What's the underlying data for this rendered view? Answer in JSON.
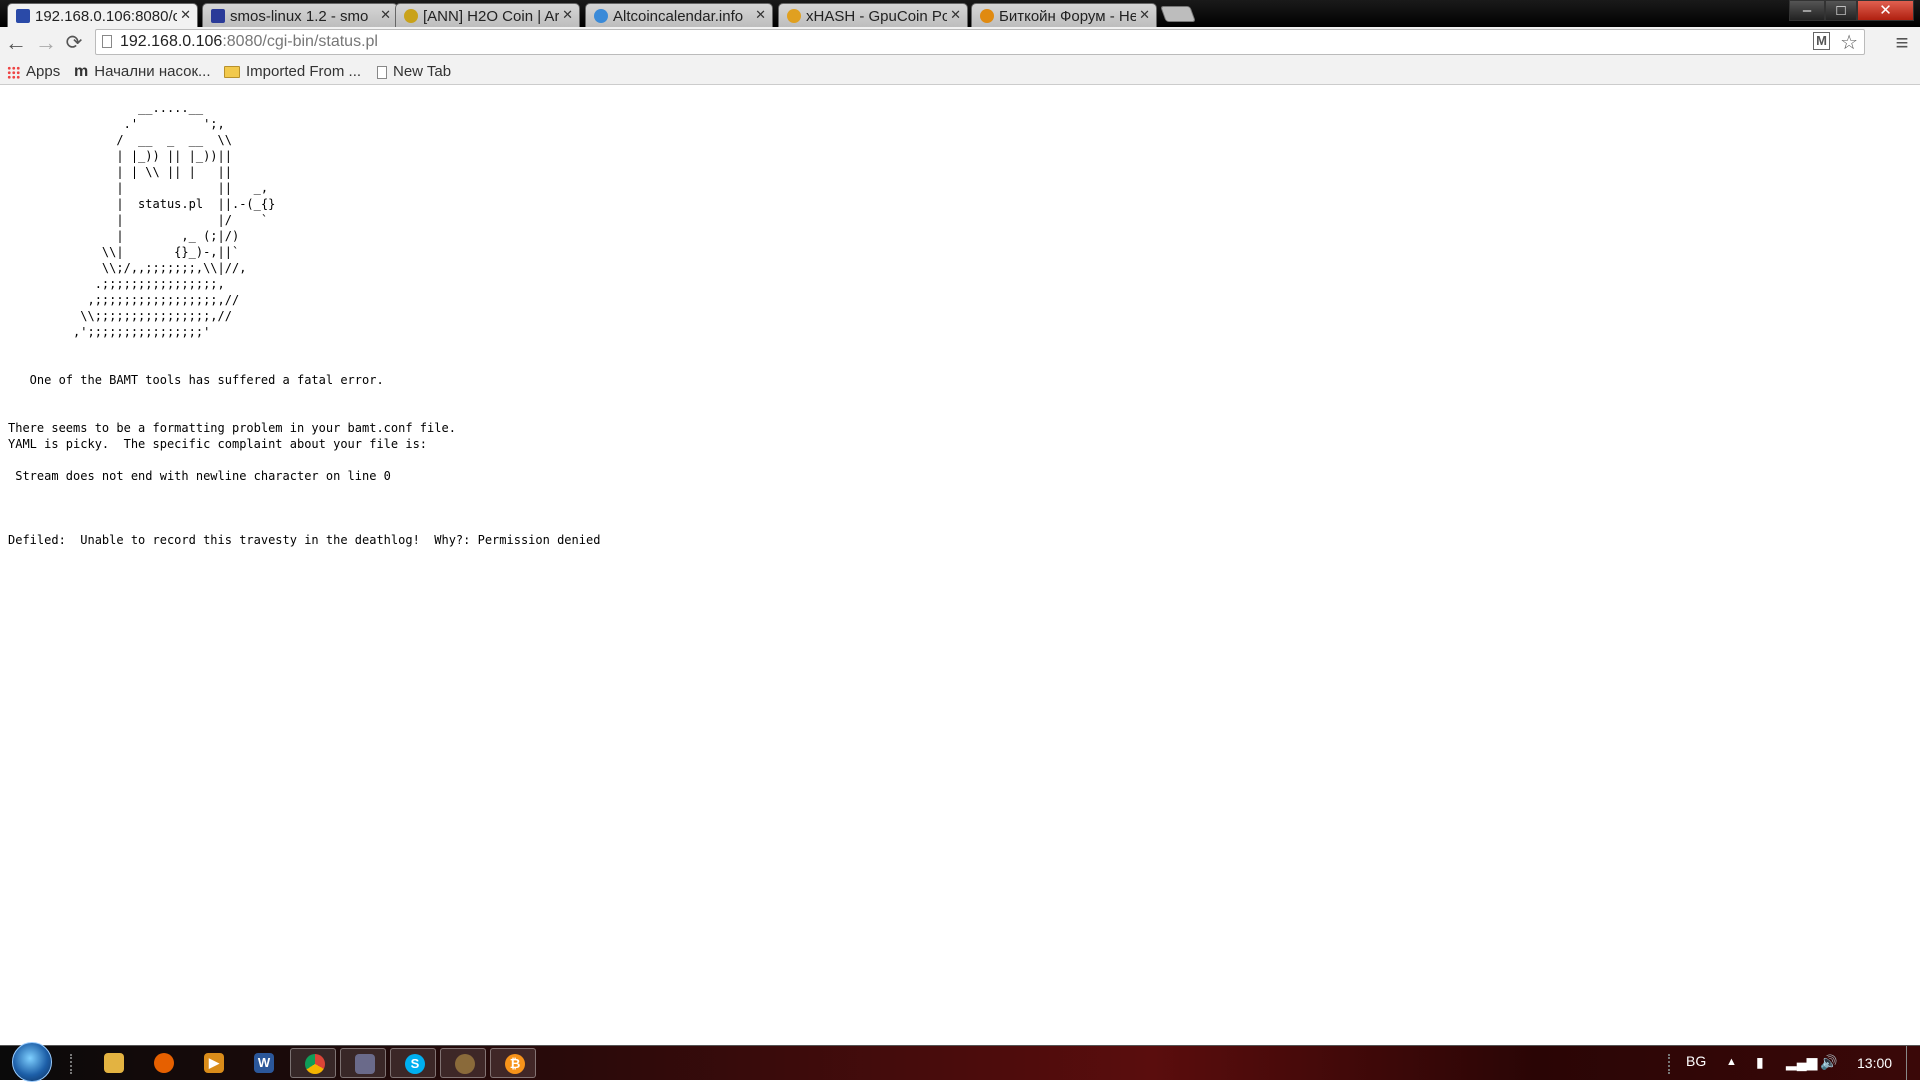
{
  "tabs": [
    {
      "title": "192.168.0.106:8080/c",
      "favicon_color": "#2a4aa8",
      "active": true
    },
    {
      "title": "smos-linux 1.2 - smo",
      "favicon_color": "#2a3a98",
      "active": false
    },
    {
      "title": "[ANN] H2O Coin | Ar",
      "favicon_color": "#c9a21a",
      "active": false
    },
    {
      "title": "Altcoincalendar.info",
      "favicon_color": "#3a8ad8",
      "active": false
    },
    {
      "title": "xHASH - GpuCoin Po",
      "favicon_color": "#e0a020",
      "active": false
    },
    {
      "title": "Биткойн Форум - Не",
      "favicon_color": "#e08a10",
      "active": false
    }
  ],
  "window_controls": {
    "minimize": "–",
    "maximize": "□",
    "close": "✕"
  },
  "toolbar": {
    "back_icon": "←",
    "forward_icon": "→",
    "reload_icon": "⟳",
    "url_host": "192.168.0.106",
    "url_path": ":8080/cgi-bin/status.pl",
    "star_icon": "☆",
    "menu_icon": "≡",
    "ext_icon": "M"
  },
  "bookmarks": [
    {
      "label": "Apps",
      "icon": "apps-grid"
    },
    {
      "label": "Начални насок...",
      "icon": "m-logo"
    },
    {
      "label": "Imported From ...",
      "icon": "folder"
    },
    {
      "label": "New Tab",
      "icon": "page"
    }
  ],
  "page": {
    "ascii_art": "                  __.....__\n                .'         ';,\n               /  __  _  __  \\\\\n               | |_)) || |_))||\n               | | \\\\ || |   ||\n               |             ||   _,\n               |  status.pl  ||.-(_{}\n               |             |/    `\n               |        ,_ (;|/)\n             \\\\|       {}_)-,||`\n             \\\\;/,,;;;;;;;,\\\\|//,\n            .;;;;;;;;;;;;;;;;,\n           ,;;;;;;;;;;;;;;;;;,//\n          \\\\;;;;;;;;;;;;;;;;,//\n         ,';;;;;;;;;;;;;;;;'",
    "fatal": "   One of the BAMT tools has suffered a fatal error.",
    "problem_line1": "There seems to be a formatting problem in your bamt.conf file.",
    "problem_line2": "YAML is picky.  The specific complaint about your file is:",
    "complaint": " Stream does not end with newline character on line 0",
    "defiled": "Defiled:  Unable to record this travesty in the deathlog!  Why?: Permission denied"
  },
  "taskbar": {
    "apps": [
      {
        "name": "explorer",
        "color": "#e3b341",
        "glyph": "",
        "running": false
      },
      {
        "name": "firefox",
        "color": "#e66000",
        "glyph": "",
        "running": false
      },
      {
        "name": "media-player",
        "color": "#d98c1a",
        "glyph": "▶",
        "running": false
      },
      {
        "name": "word",
        "color": "#2b579a",
        "glyph": "W",
        "running": false
      },
      {
        "name": "chrome",
        "color": "#3aa757",
        "glyph": "",
        "running": true
      },
      {
        "name": "remote-tool",
        "color": "#6a6a8a",
        "glyph": "",
        "running": true
      },
      {
        "name": "skype",
        "color": "#00aff0",
        "glyph": "S",
        "running": true
      },
      {
        "name": "mining-app",
        "color": "#8a6a3a",
        "glyph": "",
        "running": true
      },
      {
        "name": "bitcoin",
        "color": "#f7931a",
        "glyph": "₿",
        "running": true
      }
    ],
    "language": "BG",
    "clock": "13:00"
  }
}
